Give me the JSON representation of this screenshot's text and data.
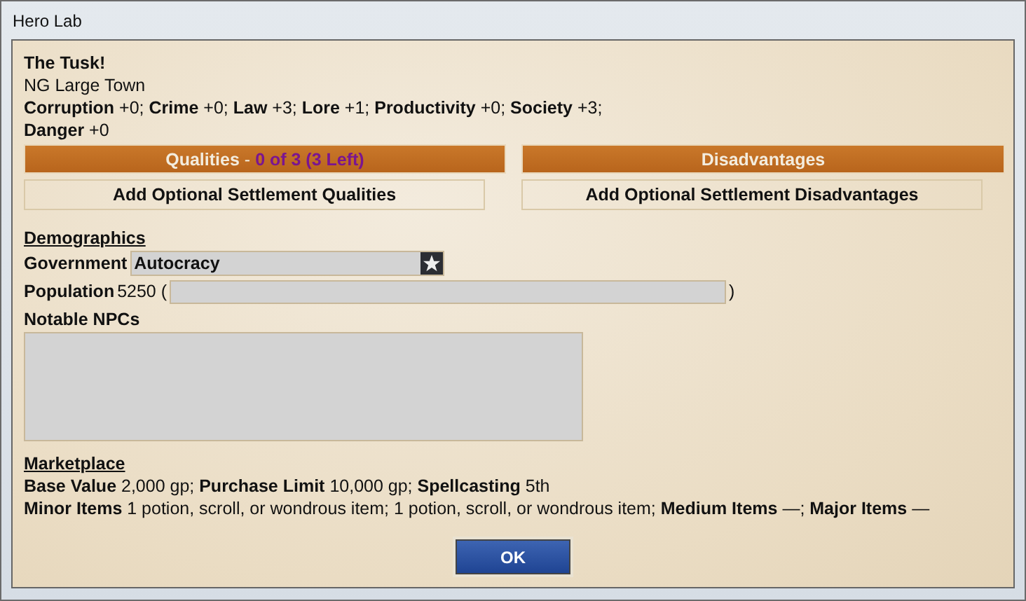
{
  "window": {
    "title": "Hero Lab"
  },
  "settlement": {
    "name": "The Tusk!",
    "type": "NG Large Town",
    "modifiers": "**Corruption** +0; **Crime** +0; **Law** +3; **Lore** +1; **Productivity** +0; **Society** +3;",
    "danger": "**Danger** +0"
  },
  "columns": [
    {
      "header": "Qualities",
      "separator": "-",
      "count": "0 of 3 (3 Left)",
      "button": "Add Optional Settlement Qualities"
    },
    {
      "header": "Disadvantages",
      "button": "Add Optional Settlement Disadvantages"
    }
  ],
  "demographics": {
    "heading": "Demographics",
    "government_label": "Government",
    "government_value": "Autocracy",
    "population_label": "Population",
    "population_value": "5250 (",
    "population_close": ")",
    "npcs_label": "Notable NPCs"
  },
  "marketplace": {
    "heading": "Marketplace",
    "line_1": "**Base Value** 2,000 gp; **Purchase Limit** 10,000 gp; **Spellcasting** 5th",
    "line_2": "**Minor Items** 1 potion, scroll, or wondrous item; 1 potion, scroll, or wondrous item; **Medium Items** —; **Major Items** —"
  },
  "buttons": [
    "OK"
  ]
}
